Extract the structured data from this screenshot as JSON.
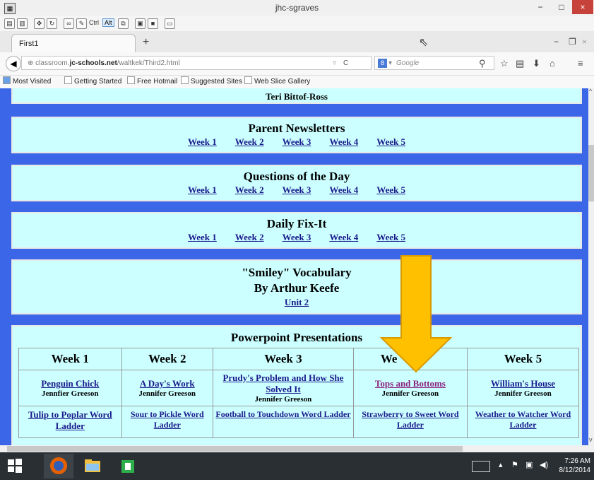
{
  "window": {
    "title": "jhc-sgraves",
    "minimize": "−",
    "maximize": "□",
    "close": "×"
  },
  "toolbar_icons": [
    "properties-icon",
    "notes-icon",
    "tools-icon",
    "refresh-icon",
    "link-icon",
    "paint-icon",
    "ctrl-key-icon",
    "alt-key-icon",
    "copy-icon",
    "paste-icon",
    "save-icon",
    "window-icon"
  ],
  "toolbar_keys": {
    "ctrl": "Ctrl",
    "alt": "Alt"
  },
  "tab": {
    "label": "First1",
    "new_tab": "+"
  },
  "nav": {
    "url_prefix": "classroom.",
    "url_domain": "jc-schools.net",
    "url_path": "/waltkek/Third2.html",
    "search_placeholder": "Google",
    "search_engine": "8"
  },
  "bookmarks": [
    "Most Visited",
    "Getting Started",
    "Free Hotmail",
    "Suggested Sites",
    "Web Slice Gallery"
  ],
  "page": {
    "top_name": "Teri Bittof-Ross",
    "sections": [
      {
        "title": "Parent Newsletters",
        "links": [
          "Week 1",
          "Week 2",
          "Week 3",
          "Week 4",
          "Week 5"
        ]
      },
      {
        "title": "Questions of the Day",
        "links": [
          "Week 1",
          "Week 2",
          "Week 3",
          "Week 4",
          "Week 5"
        ]
      },
      {
        "title": "Daily Fix-It",
        "links": [
          "Week 1",
          "Week 2",
          "Week 3",
          "Week 4",
          "Week 5"
        ]
      }
    ],
    "vocab": {
      "line1": "\"Smiley\" Vocabulary",
      "line2": "By Arthur Keefe",
      "link": "Unit 2"
    },
    "ppt": {
      "title": "Powerpoint Presentations",
      "headers": [
        "Week 1",
        "Week 2",
        "Week 3",
        "We",
        "Week 5"
      ],
      "row1": [
        {
          "link": "Penguin Chick",
          "author": "Jennfier Greeson"
        },
        {
          "link": "A Day's Work",
          "author": "Jennifer Greeson"
        },
        {
          "link": "Prudy's Problem and How She Solved It",
          "author": "Jennifer Greeson"
        },
        {
          "link": "Tops and Bottoms",
          "author": "Jennifer Greeson"
        },
        {
          "link": "William's House",
          "author": "Jennifer Greeson"
        }
      ],
      "row2": [
        "Tulip to Poplar Word Ladder",
        "Sour to Pickle Word Ladder",
        "Football to Touchdown Word Ladder",
        "Strawberry to Sweet Word Ladder",
        "Weather to Watcher Word Ladder"
      ]
    }
  },
  "taskbar": {
    "time": "7:26 AM",
    "date": "8/12/2014"
  },
  "colors": {
    "page_bg": "#3c66e8",
    "panel_bg": "#ccffff",
    "link": "#1a1a8c",
    "visited": "#8b1f7f",
    "arrow": "#ffc000"
  }
}
